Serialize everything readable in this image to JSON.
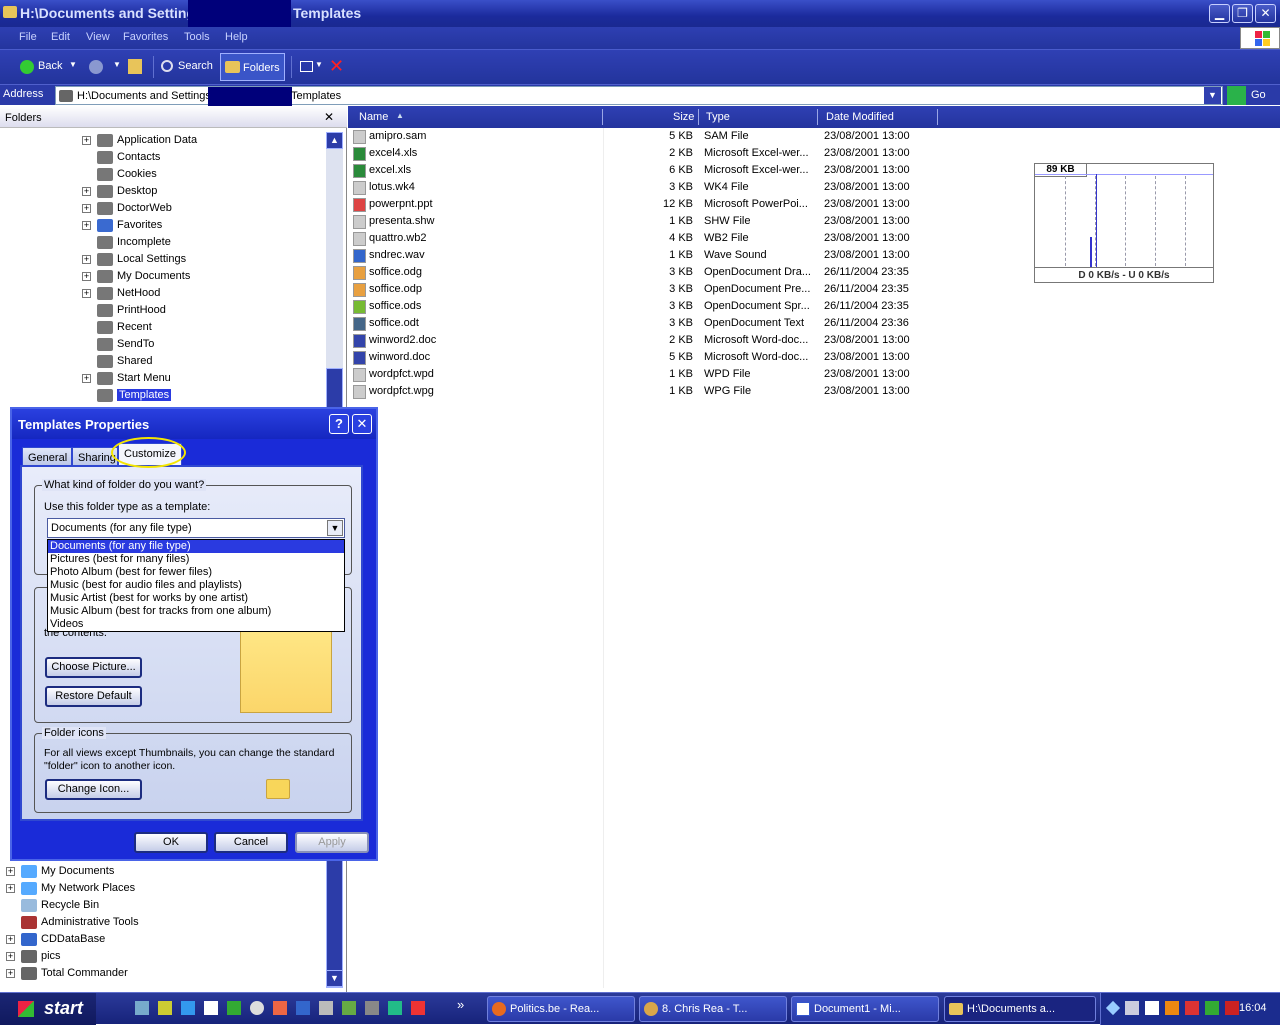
{
  "window": {
    "title_prefix": "H:\\Documents and Settings",
    "title_suffix": "Templates",
    "buttons": {
      "minimize": "▁",
      "restore": "❐",
      "close": "✕"
    }
  },
  "menu": [
    "File",
    "Edit",
    "View",
    "Favorites",
    "Tools",
    "Help"
  ],
  "toolbar": {
    "back_label": "Back",
    "search_label": "Search",
    "folders_label": "Folders"
  },
  "address": {
    "label": "Address",
    "path_prefix": "H:\\Documents and Settings",
    "path_suffix": "Templates",
    "go_label": "Go"
  },
  "folders_pane": {
    "header": "Folders",
    "close_icon": "✕",
    "tree": [
      {
        "label": "Application Data",
        "expander": "+"
      },
      {
        "label": "Contacts",
        "expander": ""
      },
      {
        "label": "Cookies",
        "expander": ""
      },
      {
        "label": "Desktop",
        "expander": "+"
      },
      {
        "label": "DoctorWeb",
        "expander": "+"
      },
      {
        "label": "Favorites",
        "expander": "+"
      },
      {
        "label": "Incomplete",
        "expander": ""
      },
      {
        "label": "Local Settings",
        "expander": "+"
      },
      {
        "label": "My Documents",
        "expander": "+"
      },
      {
        "label": "NetHood",
        "expander": "+"
      },
      {
        "label": "PrintHood",
        "expander": ""
      },
      {
        "label": "Recent",
        "expander": ""
      },
      {
        "label": "SendTo",
        "expander": ""
      },
      {
        "label": "Shared",
        "expander": ""
      },
      {
        "label": "Start Menu",
        "expander": "+"
      },
      {
        "label": "Templates",
        "expander": ""
      }
    ],
    "tree_bottom": [
      {
        "label": "My Documents",
        "expander": "+"
      },
      {
        "label": "My Network Places",
        "expander": "+"
      },
      {
        "label": "Recycle Bin",
        "expander": ""
      },
      {
        "label": "Administrative Tools",
        "expander": ""
      },
      {
        "label": "CDDataBase",
        "expander": "+"
      },
      {
        "label": "pics",
        "expander": "+"
      },
      {
        "label": "Total Commander",
        "expander": "+"
      }
    ]
  },
  "file_list": {
    "columns": {
      "name": "Name",
      "size": "Size",
      "type": "Type",
      "date": "Date Modified"
    },
    "rows": [
      {
        "name": "amipro.sam",
        "size": "5 KB",
        "type": "SAM File",
        "date": "23/08/2001 13:00"
      },
      {
        "name": "excel4.xls",
        "size": "2 KB",
        "type": "Microsoft Excel-wer...",
        "date": "23/08/2001 13:00"
      },
      {
        "name": "excel.xls",
        "size": "6 KB",
        "type": "Microsoft Excel-wer...",
        "date": "23/08/2001 13:00"
      },
      {
        "name": "lotus.wk4",
        "size": "3 KB",
        "type": "WK4 File",
        "date": "23/08/2001 13:00"
      },
      {
        "name": "powerpnt.ppt",
        "size": "12 KB",
        "type": "Microsoft PowerPoi...",
        "date": "23/08/2001 13:00"
      },
      {
        "name": "presenta.shw",
        "size": "1 KB",
        "type": "SHW File",
        "date": "23/08/2001 13:00"
      },
      {
        "name": "quattro.wb2",
        "size": "4 KB",
        "type": "WB2 File",
        "date": "23/08/2001 13:00"
      },
      {
        "name": "sndrec.wav",
        "size": "1 KB",
        "type": "Wave Sound",
        "date": "23/08/2001 13:00"
      },
      {
        "name": "soffice.odg",
        "size": "3 KB",
        "type": "OpenDocument Dra...",
        "date": "26/11/2004 23:35"
      },
      {
        "name": "soffice.odp",
        "size": "3 KB",
        "type": "OpenDocument Pre...",
        "date": "26/11/2004 23:35"
      },
      {
        "name": "soffice.ods",
        "size": "3 KB",
        "type": "OpenDocument Spr...",
        "date": "26/11/2004 23:35"
      },
      {
        "name": "soffice.odt",
        "size": "3 KB",
        "type": "OpenDocument Text",
        "date": "26/11/2004 23:36"
      },
      {
        "name": "winword2.doc",
        "size": "2 KB",
        "type": "Microsoft Word-doc...",
        "date": "23/08/2001 13:00"
      },
      {
        "name": "winword.doc",
        "size": "5 KB",
        "type": "Microsoft Word-doc...",
        "date": "23/08/2001 13:00"
      },
      {
        "name": "wordpfct.wpd",
        "size": "1 KB",
        "type": "WPD File",
        "date": "23/08/2001 13:00"
      },
      {
        "name": "wordpfct.wpg",
        "size": "1 KB",
        "type": "WPG File",
        "date": "23/08/2001 13:00"
      }
    ]
  },
  "net_graph": {
    "peak_label": "89 KB",
    "footer": "D 0 KB/s - U 0 KB/s"
  },
  "dialog": {
    "title": "Templates Properties",
    "help_icon": "?",
    "close_icon": "✕",
    "tabs": [
      "General",
      "Sharing",
      "Customize"
    ],
    "group1_label": "What kind of folder do you want?",
    "template_label": "Use this folder type as a template:",
    "selected_type": "Documents (for any file type)",
    "options": [
      "Documents (for any file type)",
      "Pictures (best for many files)",
      "Photo Album (best for fewer files)",
      "Music (best for audio files and playlists)",
      "Music Artist (best for works by one artist)",
      "Music Album (best for tracks from one album)",
      "Videos"
    ],
    "partial_text": "the contents.",
    "choose_picture": "Choose Picture...",
    "restore_default": "Restore Default",
    "group3_label": "Folder icons",
    "icons_desc_1": "For all views except Thumbnails, you can change the standard",
    "icons_desc_2": "\"folder\" icon to another icon.",
    "change_icon": "Change Icon...",
    "ok": "OK",
    "cancel": "Cancel",
    "apply": "Apply"
  },
  "taskbar": {
    "start": "start",
    "overflow": "»",
    "tasks": [
      "Politics.be - Rea...",
      "8. Chris Rea - T...",
      "Document1 - Mi...",
      "H:\\Documents a..."
    ],
    "clock": "16:04"
  },
  "colors": {
    "xp_blue": "#1a2bd8",
    "title_dark": "#1b2a9c",
    "selection": "#2a3ae0",
    "highlight_ring": "#f5e600"
  }
}
